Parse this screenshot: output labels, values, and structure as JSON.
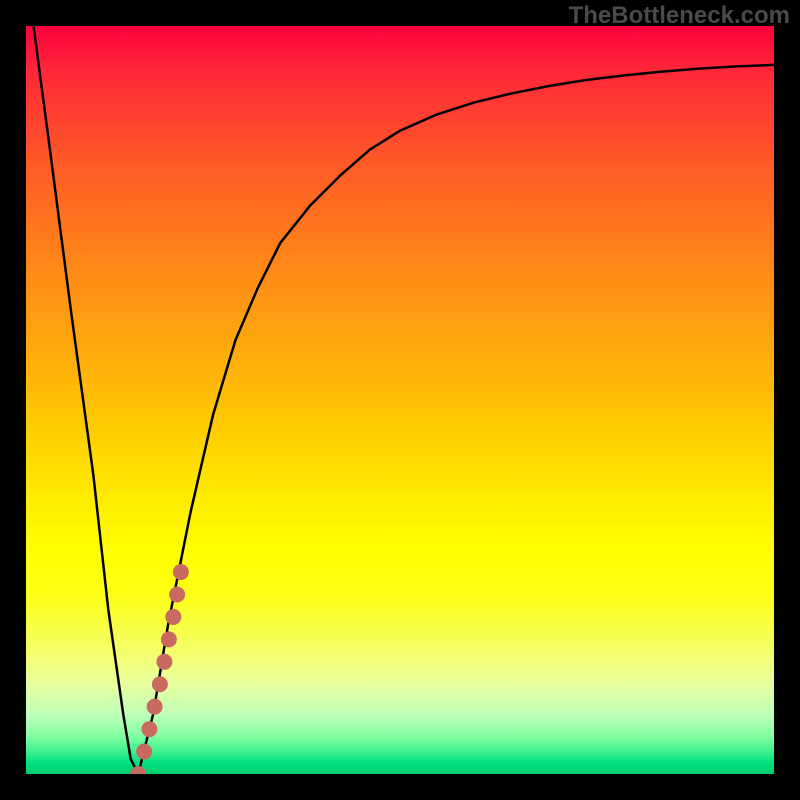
{
  "watermark": "TheBottleneck.com",
  "colors": {
    "curve_stroke": "#000000",
    "dot_fill": "#c96a60",
    "dot_stroke": "#b55850"
  },
  "chart_data": {
    "type": "line",
    "title": "",
    "xlabel": "",
    "ylabel": "",
    "xlim": [
      0,
      100
    ],
    "ylim": [
      0,
      100
    ],
    "series": [
      {
        "name": "bottleneck-curve",
        "x": [
          1,
          3,
          6,
          9,
          11,
          13,
          14,
          15,
          17,
          19,
          22,
          25,
          28,
          31,
          34,
          38,
          42,
          46,
          50,
          55,
          60,
          65,
          70,
          75,
          80,
          85,
          90,
          95,
          100
        ],
        "y": [
          100,
          85,
          62,
          40,
          22,
          8,
          2,
          0,
          8,
          20,
          35,
          48,
          58,
          65,
          71,
          76,
          80,
          83.5,
          86,
          88.2,
          89.8,
          91,
          92,
          92.8,
          93.4,
          93.9,
          94.3,
          94.6,
          94.8
        ]
      }
    ],
    "dots": {
      "name": "highlight-segment",
      "points": [
        {
          "x": 15.0,
          "y": 0
        },
        {
          "x": 15.8,
          "y": 3
        },
        {
          "x": 16.5,
          "y": 6
        },
        {
          "x": 17.2,
          "y": 9
        },
        {
          "x": 17.9,
          "y": 12
        },
        {
          "x": 18.5,
          "y": 15
        },
        {
          "x": 19.1,
          "y": 18
        },
        {
          "x": 19.7,
          "y": 21
        },
        {
          "x": 20.2,
          "y": 24
        },
        {
          "x": 20.7,
          "y": 27
        }
      ]
    }
  }
}
